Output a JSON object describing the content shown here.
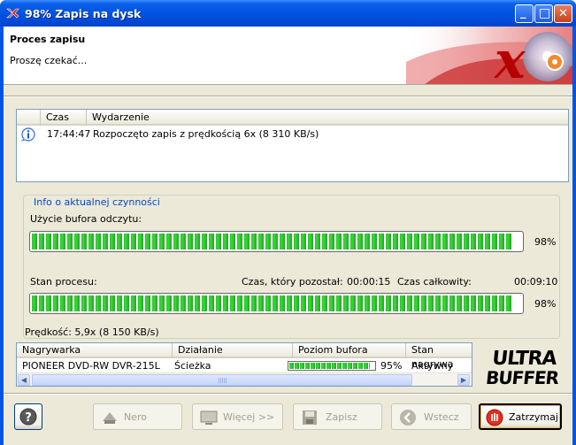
{
  "window": {
    "title": "98% Zapis na dysk",
    "buttons": {
      "minimize": "_",
      "maximize": "□",
      "close": "✕"
    }
  },
  "header": {
    "title": "Proces zapisu",
    "subtitle": "Proszę czekać..."
  },
  "log": {
    "columns": [
      "",
      "Czas",
      "Wydarzenie"
    ],
    "rows": [
      {
        "icon": "info-icon",
        "time": "17:44:47",
        "event": "Rozpoczęto zapis z prędkością 6x (8 310 KB/s)"
      }
    ]
  },
  "activity": {
    "group_label": "Info o aktualnej czynności",
    "buffer_label": "Użycie bufora odczytu:",
    "buffer_percent_text": "98%",
    "buffer_fraction": 0.98,
    "process_label": "Stan procesu:",
    "remaining_label": "Czas, który pozostał:",
    "remaining_value": "00:00:15",
    "total_label": "Czas całkowity:",
    "total_value": "00:09:10",
    "process_percent_text": "98%",
    "process_fraction": 0.98
  },
  "speed_text": "Prędkość: 5,9x (8 150 KB/s)",
  "drives": {
    "columns": [
      "Nagrywarka",
      "Działanie",
      "Poziom bufora",
      "Stan nagrywa"
    ],
    "rows": [
      {
        "recorder": "PIONEER DVD-RW  DVR-215L",
        "action": "Ścieżka",
        "buffer_text": "95%",
        "buffer_fraction": 0.95,
        "state": "Aktywny"
      }
    ]
  },
  "logos": {
    "top": "nero-x-logo",
    "bottom": "ULTRA BUFFER"
  },
  "buttons": {
    "help": "?",
    "nero": "Nero",
    "more": "Więcej >>",
    "save": "Zapisz",
    "back": "Wstecz",
    "stop": "Zatrzymaj"
  },
  "colors": {
    "titlebar": "#0054e3",
    "accent": "#0046d5",
    "progress": "#2ac22a",
    "client": "#ece9d8"
  }
}
